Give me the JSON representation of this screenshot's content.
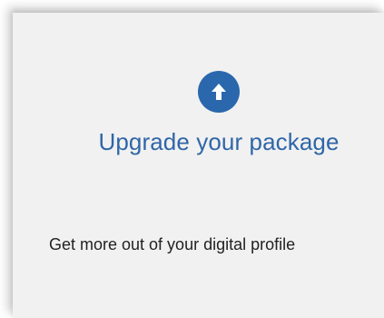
{
  "card": {
    "icon": "arrow-up-circle-icon",
    "title": "Upgrade your package",
    "description": "Get more out of your digital profile"
  },
  "colors": {
    "accent": "#2b67ad",
    "title": "#2f66a8",
    "background": "#f1f1f1",
    "text": "#222222"
  }
}
